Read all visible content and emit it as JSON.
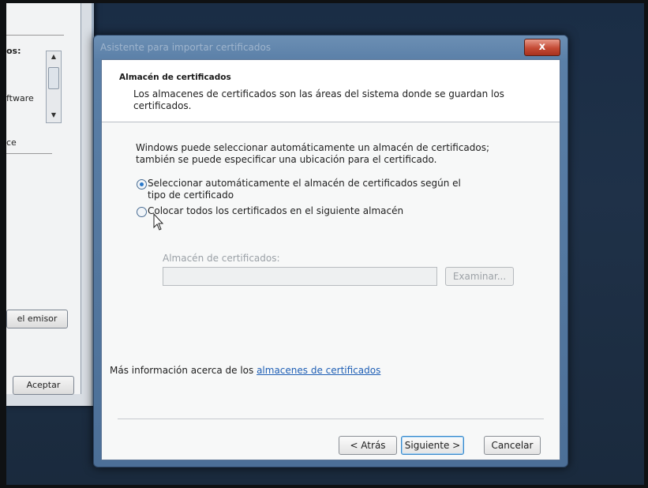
{
  "background_window": {
    "label_1": "os:",
    "label_2": "ftware",
    "label_3": "ce",
    "issuer_button": "el emisor",
    "accept_button": "Aceptar"
  },
  "dialog": {
    "title": "Asistente para importar certificados",
    "close_glyph": "x",
    "header": {
      "title": "Almacén de certificados",
      "description": "Los almacenes de certificados son las áreas del sistema donde se guardan los certificados."
    },
    "intro": "Windows puede seleccionar automáticamente un almacén de certificados; también se puede especificar una ubicación para el certificado.",
    "options": [
      {
        "label": "Seleccionar automáticamente el almacén de certificados según el tipo de certificado",
        "checked": true
      },
      {
        "label": "Colocar todos los certificados en el siguiente almacén",
        "checked": false
      }
    ],
    "store_label": "Almacén de certificados:",
    "store_value": "",
    "browse_button": "Examinar...",
    "more_info_prefix": "Más información acerca de los ",
    "more_info_link": "almacenes de certificados",
    "back_button": "< Atrás",
    "next_button": "Siguiente >",
    "cancel_button": "Cancelar"
  },
  "icons": {
    "close": "close-icon",
    "cursor": "mouse-pointer-icon",
    "scroll_up": "scroll-up-arrow-icon",
    "scroll_down": "scroll-down-arrow-icon"
  },
  "colors": {
    "accent": "#2a78c9",
    "link": "#1f5fb5",
    "close": "#c44a34"
  }
}
